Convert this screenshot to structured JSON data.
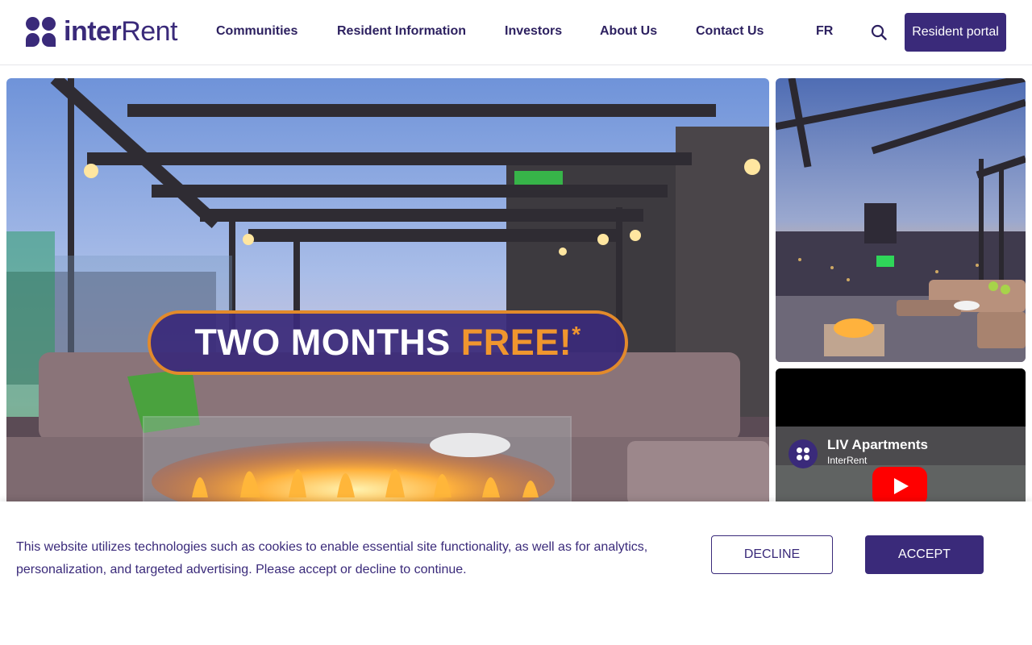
{
  "brand": {
    "name_bold": "inter",
    "name_light": "Rent",
    "color": "#3a2a7a"
  },
  "nav": {
    "items": [
      {
        "label": "Communities"
      },
      {
        "label": "Resident Information"
      },
      {
        "label": "Investors"
      },
      {
        "label": "About Us"
      },
      {
        "label": "Contact Us"
      },
      {
        "label": "FR"
      }
    ],
    "search_icon": "search-icon",
    "portal_label": "Resident portal"
  },
  "hero": {
    "promo_main": "TWO MONTHS ",
    "promo_accent": "FREE!",
    "promo_mark": "*",
    "accent_color": "#f0962e"
  },
  "video": {
    "title": "LIV Apartments",
    "channel": "InterRent",
    "play_icon": "youtube-play-icon"
  },
  "cookie": {
    "message": "This website utilizes technologies such as cookies to enable essential site functionality, as well as for analytics, personalization, and targeted advertising. Please accept or decline to continue.",
    "decline_label": "DECLINE",
    "accept_label": "ACCEPT"
  }
}
